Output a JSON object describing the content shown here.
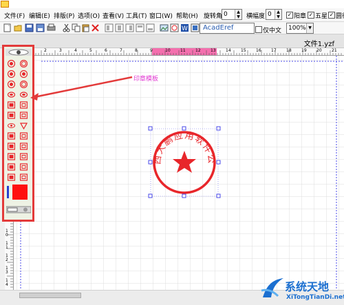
{
  "menu": {
    "items": [
      "文件(F)",
      "编辑(E)",
      "排版(P)",
      "选项(O)",
      "查看(V)",
      "工具(T)",
      "窗口(W)",
      "帮助(H)"
    ]
  },
  "format_bar": {
    "rotation_label": "旋转角:",
    "rotation_value": "0",
    "scale_label": "横幅度:",
    "scale_value": "0",
    "checkboxes": [
      {
        "label": "阳章",
        "checked": true
      },
      {
        "label": "五星",
        "checked": true
      },
      {
        "label": "圆行",
        "checked": true
      }
    ]
  },
  "toolbar": {
    "font_name": "AcadEref",
    "center_checkbox_label": "仅中文",
    "zoom_value": "100%"
  },
  "document": {
    "tab_name": "文件1.yzf"
  },
  "ruler": {
    "top_labels": [
      "1",
      "2",
      "3",
      "4",
      "5",
      "6",
      "7",
      "8",
      "9",
      "10",
      "11",
      "12",
      "13",
      "14",
      "15",
      "16",
      "17",
      "18",
      "19",
      "20",
      "21"
    ],
    "left_labels": [
      "10",
      "11",
      "12",
      "13",
      "14",
      "15"
    ]
  },
  "annotation": {
    "label": "印章模板"
  },
  "stamp": {
    "text": "广西大鹏应用软件公司",
    "color": "#e8262b"
  },
  "watermark": {
    "name": "系统天地",
    "url": "XiTongTianDi.net"
  },
  "colors": {
    "accent_red": "#e8262b",
    "highlight_frame": "#e33a3a",
    "annotation": "#e23bd3",
    "watermark_blue": "#1b6fd0"
  }
}
